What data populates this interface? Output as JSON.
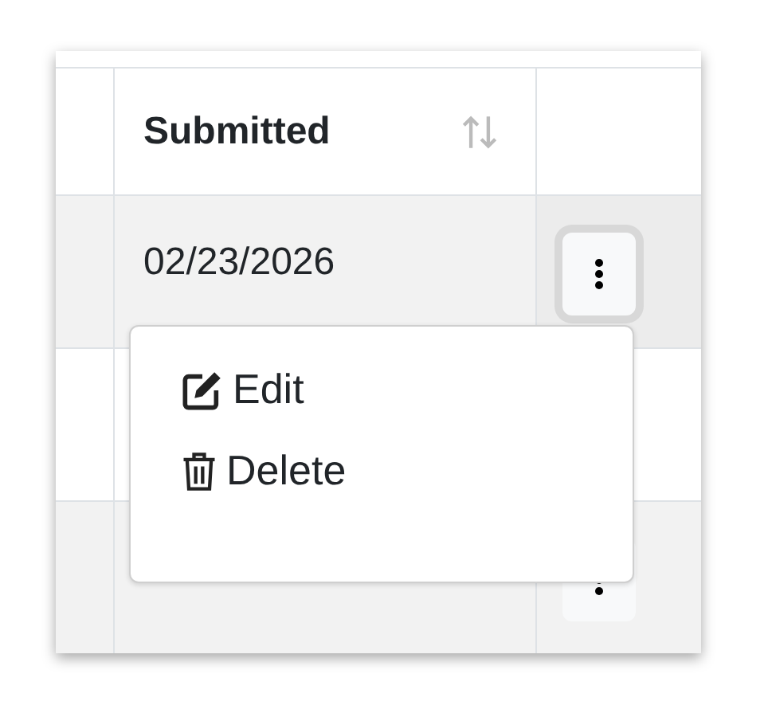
{
  "table": {
    "header": "Submitted",
    "rows": [
      {
        "submitted": "02/23/2026",
        "menu_open": true
      },
      {
        "menu_open": false
      },
      {
        "menu_open": false
      }
    ]
  },
  "menu": {
    "items": [
      {
        "label": "Edit",
        "kind": "edit"
      },
      {
        "label": "Delete",
        "kind": "delete"
      }
    ]
  }
}
